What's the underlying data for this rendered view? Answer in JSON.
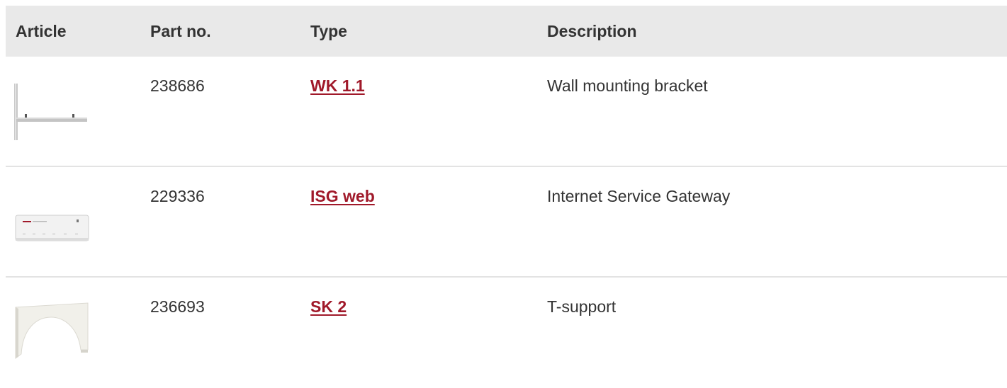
{
  "table": {
    "headers": {
      "article": "Article",
      "part_no": "Part no.",
      "type": "Type",
      "description": "Description"
    },
    "rows": [
      {
        "image_icon": "wall-mounting-bracket-image",
        "part_no": "238686",
        "type": "WK 1.1",
        "description": "Wall mounting bracket"
      },
      {
        "image_icon": "internet-service-gateway-image",
        "part_no": "229336",
        "type": "ISG web",
        "description": "Internet Service Gateway"
      },
      {
        "image_icon": "t-support-image",
        "part_no": "236693",
        "type": "SK 2",
        "description": "T-support"
      }
    ]
  },
  "colors": {
    "header_bg": "#e9e9e9",
    "link": "#a0192a",
    "text": "#333333",
    "divider": "#e3e3e3"
  }
}
